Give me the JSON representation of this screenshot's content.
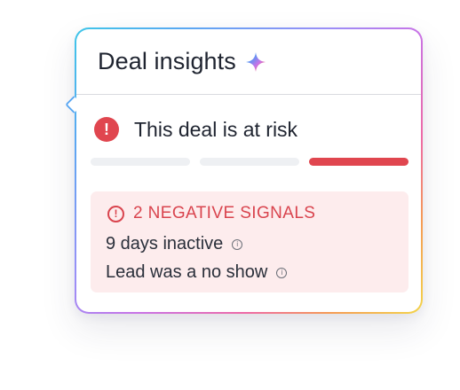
{
  "header": {
    "title": "Deal insights",
    "sparkle_icon": "ai-sparkle-icon"
  },
  "status": {
    "icon": "exclamation-circle-icon",
    "icon_glyph": "!",
    "text": "This deal is at risk",
    "risk_level": 3,
    "risk_levels_total": 3,
    "active_color": "#e0464f",
    "inactive_color": "#eef0f3"
  },
  "signals": {
    "icon": "warning-circle-icon",
    "icon_glyph": "!",
    "title": "2 NEGATIVE SIGNALS",
    "accent_color": "#d9444e",
    "background_color": "#fdeced",
    "items": [
      {
        "label": "9 days inactive",
        "info_icon": "info-icon"
      },
      {
        "label": "Lead was a no show",
        "info_icon": "info-icon"
      }
    ]
  },
  "theme": {
    "border_gradient": [
      "#3ec6e8",
      "#9a8ef7",
      "#ee6aa6",
      "#f3d54a"
    ]
  }
}
